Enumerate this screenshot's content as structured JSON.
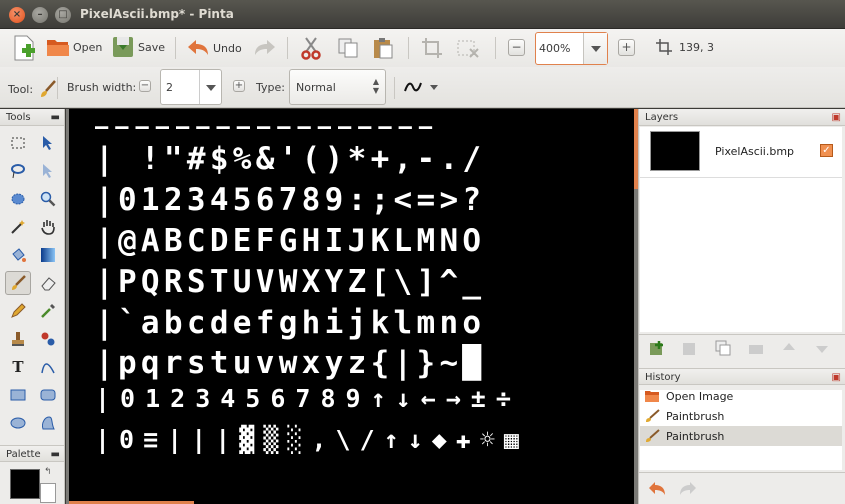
{
  "window": {
    "title": "PixelAscii.bmp* - Pinta"
  },
  "toolbar": {
    "new_label": "",
    "open_label": "Open",
    "save_label": "Save",
    "undo_label": "Undo",
    "zoom_value": "400%",
    "cursor_position": "139, 3"
  },
  "tool_options": {
    "tool_label": "Tool:",
    "brush_width_label": "Brush width:",
    "brush_width_value": "2",
    "type_label": "Type:",
    "type_value": "Normal"
  },
  "panels": {
    "tools_title": "Tools",
    "palette_title": "Palette",
    "layers_title": "Layers",
    "history_title": "History"
  },
  "layers": [
    {
      "name": "PixelAscii.bmp",
      "visible": true
    }
  ],
  "history": [
    {
      "label": "Open Image",
      "icon": "open-image-icon"
    },
    {
      "label": "Paintbrush",
      "icon": "paintbrush-icon"
    },
    {
      "label": "Paintbrush",
      "icon": "paintbrush-icon",
      "selected": true
    }
  ],
  "canvas_rows": [
    "—————————————————",
    "| !\"#$%&'()*+,-./",
    "|0123456789:;<=>?",
    "|@ABCDEFGHIJKLMNO",
    "|PQRSTUVWXYZ[\\]^_",
    "|`abcdefghijklmno",
    "|pqrstuvwxyz{|}~█",
    "|0123456789↑↓←→±÷",
    "|0≡|||▓▒░,\\/↑↓◆✚☼▦"
  ],
  "colors": {
    "accent": "#e0814c",
    "primary_color": "#000000",
    "secondary_color": "#ffffff",
    "canvas_bg": "#000000"
  }
}
